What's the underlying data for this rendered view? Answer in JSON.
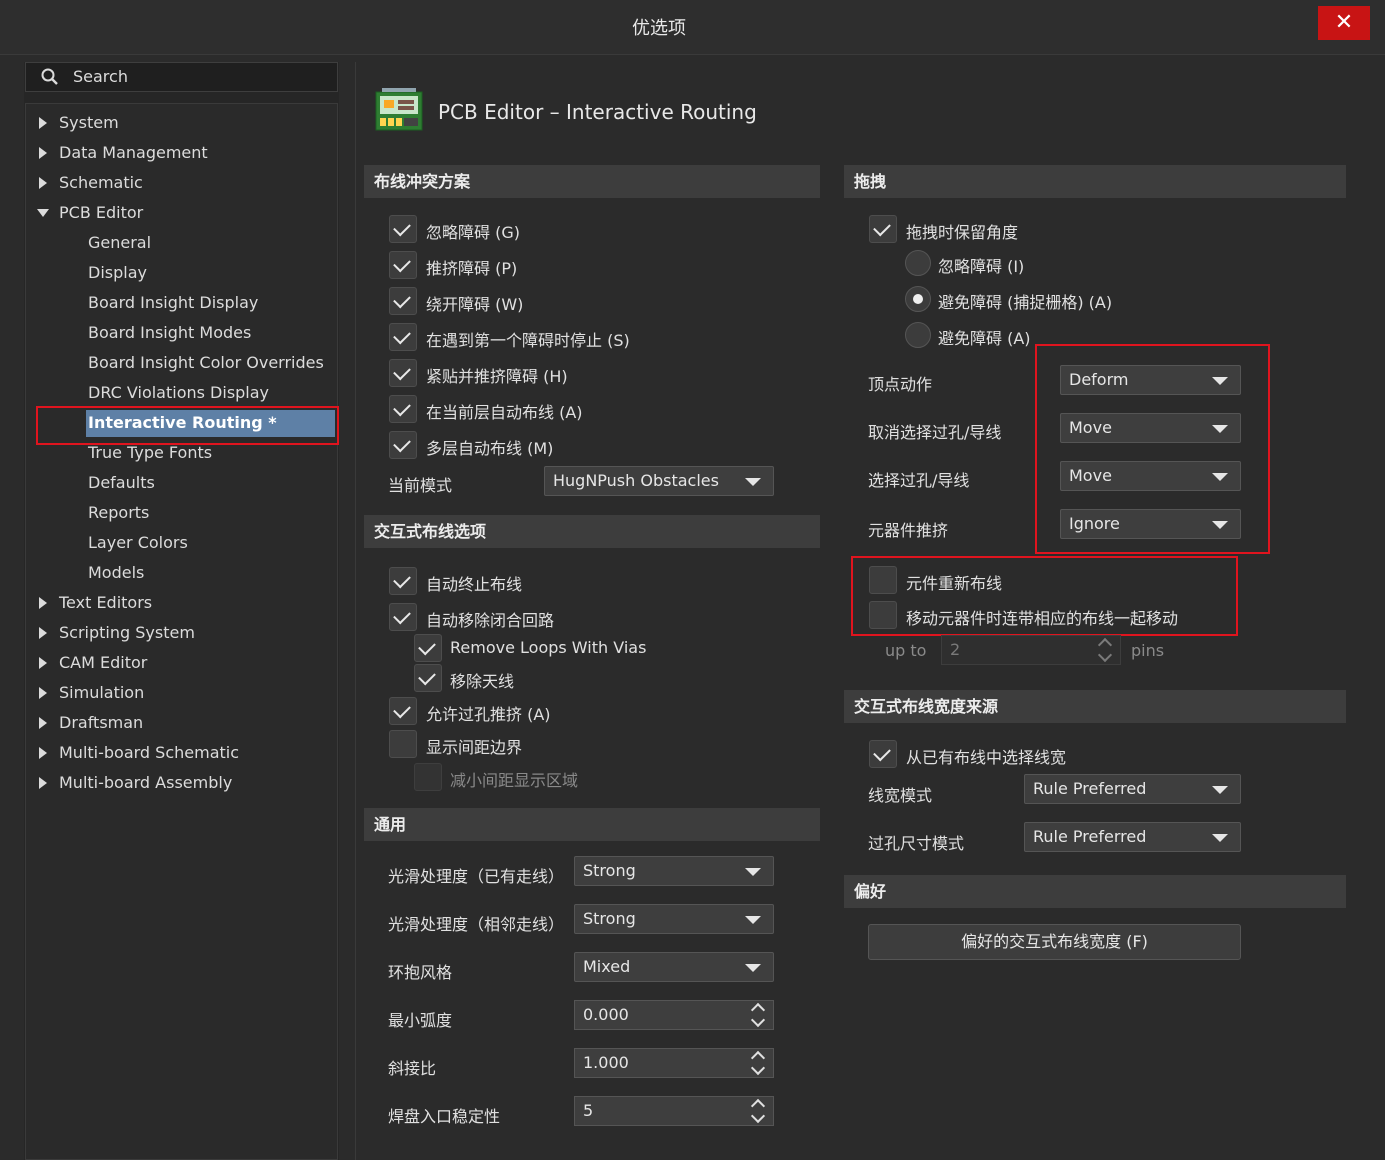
{
  "window": {
    "title": "优选项",
    "close_label": "✕"
  },
  "search": {
    "placeholder": "Search"
  },
  "tree": {
    "items": [
      {
        "label": "System"
      },
      {
        "label": "Data Management"
      },
      {
        "label": "Schematic"
      },
      {
        "label": "PCB Editor"
      },
      {
        "label": "General"
      },
      {
        "label": "Display"
      },
      {
        "label": "Board Insight Display"
      },
      {
        "label": "Board Insight Modes"
      },
      {
        "label": "Board Insight Color Overrides"
      },
      {
        "label": "DRC Violations Display"
      },
      {
        "label": "Interactive Routing *"
      },
      {
        "label": "True Type Fonts"
      },
      {
        "label": "Defaults"
      },
      {
        "label": "Reports"
      },
      {
        "label": "Layer Colors"
      },
      {
        "label": "Models"
      },
      {
        "label": "Text Editors"
      },
      {
        "label": "Scripting System"
      },
      {
        "label": "CAM Editor"
      },
      {
        "label": "Simulation"
      },
      {
        "label": "Draftsman"
      },
      {
        "label": "Multi-board Schematic"
      },
      {
        "label": "Multi-board Assembly"
      }
    ]
  },
  "page": {
    "title": "PCB Editor – Interactive Routing"
  },
  "conflict": {
    "header": "布线冲突方案",
    "options": [
      {
        "label": "忽略障碍 (G)",
        "checked": true
      },
      {
        "label": "推挤障碍 (P)",
        "checked": true
      },
      {
        "label": "绕开障碍 (W)",
        "checked": true
      },
      {
        "label": "在遇到第一个障碍时停止 (S)",
        "checked": true
      },
      {
        "label": "紧贴并推挤障碍 (H)",
        "checked": true
      },
      {
        "label": "在当前层自动布线 (A)",
        "checked": true
      },
      {
        "label": "多层自动布线 (M)",
        "checked": true
      }
    ],
    "mode_label": "当前模式",
    "mode_value": "HugNPush Obstacles"
  },
  "interactive": {
    "header": "交互式布线选项",
    "auto_terminate": "自动终止布线",
    "auto_remove_loops": "自动移除闭合回路",
    "remove_loops_vias": "Remove Loops With Vias",
    "remove_antenna": "移除天线",
    "allow_via_push": "允许过孔推挤 (A)",
    "show_clearance": "显示间距边界",
    "reduce_clearance": "减小间距显示区域"
  },
  "general": {
    "header": "通用",
    "smooth_existing_label": "光滑处理度（已有走线）",
    "smooth_existing_value": "Strong",
    "smooth_adjacent_label": "光滑处理度（相邻走线）",
    "smooth_adjacent_value": "Strong",
    "hug_style_label": "环抱风格",
    "hug_style_value": "Mixed",
    "min_arc_label": "最小弧度",
    "min_arc_value": "0.000",
    "miter_label": "斜接比",
    "miter_value": "1.000",
    "pad_entry_label": "焊盘入口稳定性",
    "pad_entry_value": "5"
  },
  "drag": {
    "header": "拖拽",
    "keep_angle": "拖拽时保留角度",
    "radio_ignore": "忽略障碍 (I)",
    "radio_avoid_snap": "避免障碍 (捕捉栅格) (A)",
    "radio_avoid": "避免障碍 (A)",
    "vertex_label": "顶点动作",
    "vertex_value": "Deform",
    "unselected_label": "取消选择过孔/导线",
    "unselected_value": "Move",
    "selected_label": "选择过孔/导线",
    "selected_value": "Move",
    "component_push_label": "元器件推挤",
    "component_push_value": "Ignore",
    "reroute_components": "元件重新布线",
    "move_with_routes": "移动元器件时连带相应的布线一起移动",
    "upto_label": "up to",
    "upto_value": "2",
    "pins_label": "pins"
  },
  "width_source": {
    "header": "交互式布线宽度来源",
    "pick_from_existing": "从已有布线中选择线宽",
    "width_mode_label": "线宽模式",
    "width_mode_value": "Rule Preferred",
    "via_mode_label": "过孔尺寸模式",
    "via_mode_value": "Rule Preferred"
  },
  "favorites": {
    "header": "偏好",
    "button_label": "偏好的交互式布线宽度 (F)"
  }
}
